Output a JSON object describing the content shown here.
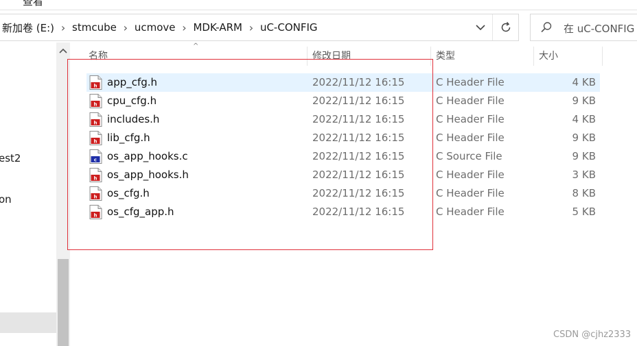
{
  "menu": {
    "peek_label": "查看"
  },
  "address": {
    "crumbs": [
      "新加卷 (E:)",
      "stmcube",
      "ucmove",
      "MDK-ARM",
      "uC-CONFIG"
    ]
  },
  "search": {
    "placeholder": "在 uC-CONFIG"
  },
  "nav": {
    "items": [
      "est2",
      "on"
    ]
  },
  "columns": {
    "name": "名称",
    "date": "修改日期",
    "type": "类型",
    "size": "大小"
  },
  "files": [
    {
      "name": "app_cfg.h",
      "date": "2022/11/12 16:15",
      "type": "C Header File",
      "size": "4 KB",
      "icon": "c-header-file-icon"
    },
    {
      "name": "cpu_cfg.h",
      "date": "2022/11/12 16:15",
      "type": "C Header File",
      "size": "9 KB",
      "icon": "c-header-file-icon"
    },
    {
      "name": "includes.h",
      "date": "2022/11/12 16:15",
      "type": "C Header File",
      "size": "4 KB",
      "icon": "c-header-file-icon"
    },
    {
      "name": "lib_cfg.h",
      "date": "2022/11/12 16:15",
      "type": "C Header File",
      "size": "9 KB",
      "icon": "c-header-file-icon"
    },
    {
      "name": "os_app_hooks.c",
      "date": "2022/11/12 16:15",
      "type": "C Source File",
      "size": "9 KB",
      "icon": "c-source-file-icon"
    },
    {
      "name": "os_app_hooks.h",
      "date": "2022/11/12 16:15",
      "type": "C Header File",
      "size": "3 KB",
      "icon": "c-header-file-icon"
    },
    {
      "name": "os_cfg.h",
      "date": "2022/11/12 16:15",
      "type": "C Header File",
      "size": "8 KB",
      "icon": "c-header-file-icon"
    },
    {
      "name": "os_cfg_app.h",
      "date": "2022/11/12 16:15",
      "type": "C Header File",
      "size": "5 KB",
      "icon": "c-header-file-icon"
    }
  ],
  "watermark": "CSDN @cjhz2333",
  "colors": {
    "annotation_box": "#e0303a",
    "hover_row": "#e5f3ff",
    "header_icon_badge": "#cc1f1f",
    "source_icon_badge": "#1f2fa8"
  }
}
